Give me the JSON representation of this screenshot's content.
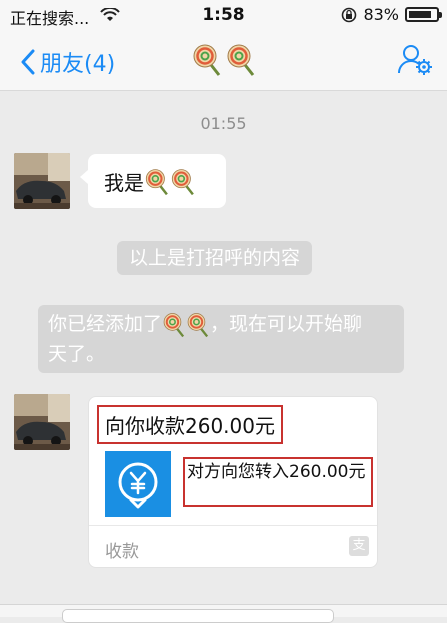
{
  "status_bar": {
    "carrier_text": "正在搜索...",
    "time": "1:58",
    "battery_percent": "83%",
    "battery_level": 0.83
  },
  "nav": {
    "back_label": "朋友(4)",
    "title_icon": "lollipop-icon",
    "contact_icon": "contact-settings-icon",
    "accent_color": "#1b8bf5"
  },
  "chat": {
    "timestamp": "01:55",
    "messages": [
      {
        "text": "我是"
      },
      {
        "system_text": "以上是打招呼的内容"
      },
      {
        "system_text_a": "你已经添加了",
        "system_text_b": "，现在可以开始聊",
        "system_text_c": "天了。"
      }
    ],
    "payment": {
      "title": "向你收款260.00元",
      "description": "对方向您转入260.00元",
      "footer_label": "收款",
      "footer_icon_text": "支",
      "icon": "yuan-download-icon",
      "icon_color": "#1a8fe3",
      "highlight_color": "#c8322f"
    }
  }
}
